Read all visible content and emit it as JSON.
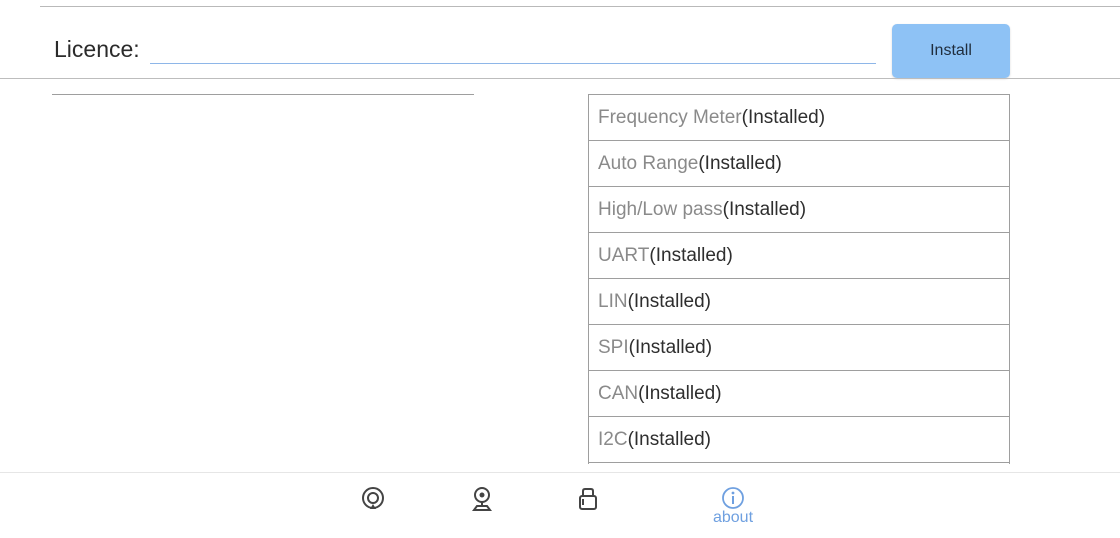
{
  "licence": {
    "label": "Licence:",
    "value": "",
    "placeholder": "",
    "install_label": "Install"
  },
  "features": [
    {
      "name": "Frequency Meter",
      "status": "(Installed)"
    },
    {
      "name": "Auto Range",
      "status": "(Installed)"
    },
    {
      "name": "High/Low pass",
      "status": "(Installed)"
    },
    {
      "name": "UART",
      "status": "(Installed)"
    },
    {
      "name": "LIN",
      "status": "(Installed)"
    },
    {
      "name": "SPI",
      "status": "(Installed)"
    },
    {
      "name": "CAN",
      "status": "(Installed)"
    },
    {
      "name": "I2C",
      "status": "(Installed)"
    }
  ],
  "nav": {
    "items": [
      {
        "icon": "scope-icon",
        "label": ""
      },
      {
        "icon": "probe-icon",
        "label": ""
      },
      {
        "icon": "module-icon",
        "label": ""
      },
      {
        "icon": "info-icon",
        "label": "about"
      }
    ],
    "active_color": "#6fa0e0"
  },
  "colors": {
    "install_button": "#8ec2f5",
    "input_underline": "#8eb6e8"
  }
}
